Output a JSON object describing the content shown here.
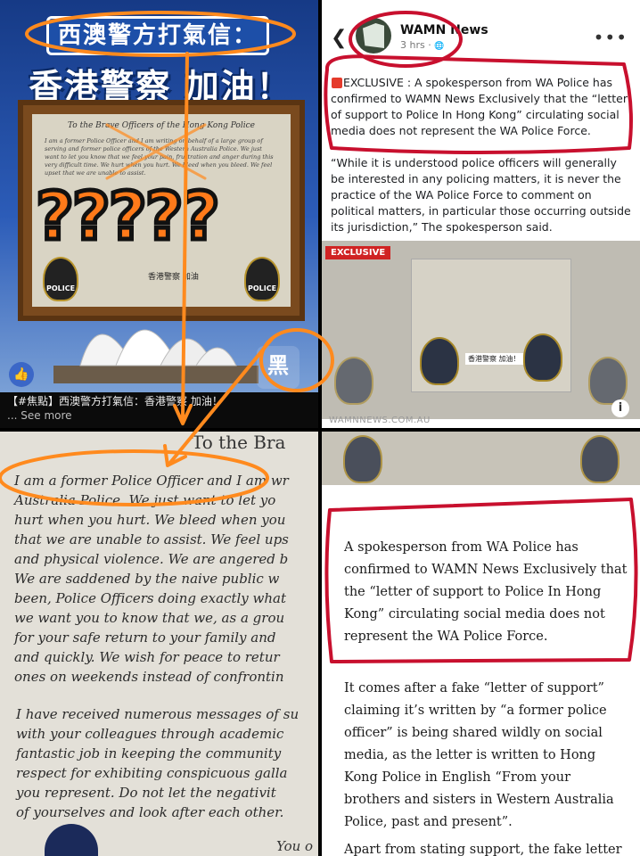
{
  "top_left": {
    "banner_title": "西澳警方打氣信：",
    "big_title": "香港警察 加油！",
    "letter_heading": "To the Brave Officers of the Hong Kong Police",
    "letter_excerpt": "I am a former Police Officer and I am writing on behalf of a large group of serving and former police officers of the Western Australia Police. We just want to let you know that we feel your pain, frustration and anger during this very difficult time. We hurt when you hurt. We bleed when you bleed. We feel upset that we are unable to assist.",
    "overlay_marks": "?????",
    "letter_cn": "香港警察 加油",
    "badge_label": "POLICE",
    "logo": "黑",
    "like_icon": "👍",
    "caption": "【#焦點】西澳警方打氣信：香港警察 加油！",
    "see_more": "... See more"
  },
  "top_right": {
    "page_name": "WAMN News",
    "time": "3 hrs · ",
    "globe_icon": "🌐",
    "paragraph1": "EXCLUSIVE : A spokesperson from WA Police has confirmed to WAMN News Exclusively that the “letter of support to Police In Hong Kong” circulating social media does not represent the WA Police Force.",
    "paragraph2": "“While it is understood police officers will generally be interested in any policing matters, it is never the practice of the WA Police Force to comment on political matters, in particular those occurring outside its jurisdiction,” The spokesperson said.",
    "exclusive_tag": "EXCLUSIVE",
    "image_cn": "香港警察 加油！",
    "info_icon": "i",
    "source": "WAMNNEWS.COM.AU"
  },
  "bottom_left": {
    "title": "To the Bra",
    "lines1": [
      "I am a former Police Officer and I am wr",
      "Australia Police. We just want to let yo",
      "hurt when you hurt. We bleed when you",
      "that we are unable to assist. We feel ups",
      "and physical violence. We are angered b",
      "We are saddened by the naive public w",
      "been, Police Officers doing exactly what",
      "we want you to know that we, as a grou",
      "for your safe return to your family and",
      "and quickly. We wish for peace to retur",
      "ones on weekends instead of confrontin"
    ],
    "lines2": [
      "I have received numerous messages of su",
      "with your colleagues through academic",
      "fantastic job in keeping the community",
      "respect for exhibiting conspicuous galla",
      "you represent. Do not let the negativit",
      "of yourselves and look after each other."
    ],
    "sign": "You o"
  },
  "bottom_right": {
    "para1": "A spokesperson from WA Police has confirmed to WAMN News Exclusively that the “letter of support to Police In Hong Kong” circulating social media does not represent the WA Police Force.",
    "para2": "It comes after a fake “letter of support” claiming it’s written by “a former police officer” is being shared wildly on social media, as the letter is written to Hong Kong Police in English “From your brothers and sisters in Western Australia Police, past and present”.",
    "para3": "Apart from stating support, the fake letter has two"
  },
  "colors": {
    "orange_annotation": "#ff8a1e",
    "red_annotation": "#c8102e",
    "exclusive_red": "#d02323"
  }
}
